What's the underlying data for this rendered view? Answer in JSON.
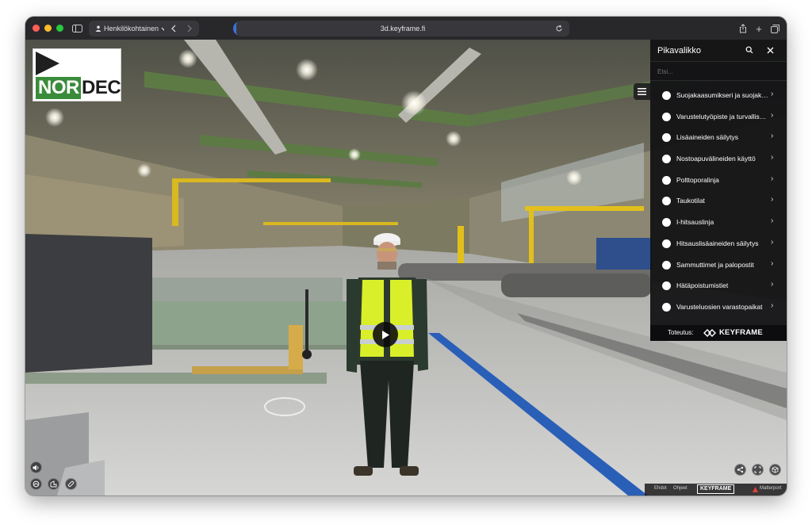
{
  "browser": {
    "profile_label": "Henkilökohtainen",
    "url": "3d.keyframe.fi"
  },
  "logo": {
    "part1": "NOR",
    "part2": "DEC"
  },
  "panel": {
    "title": "Pikavalikko",
    "search_placeholder": "Etsi...",
    "items": [
      {
        "label": "Suojakaasumikseri ja suojakaasut"
      },
      {
        "label": "Varustelutyöpiste ja turvallisuus"
      },
      {
        "label": "Lisäaineiden säilytys"
      },
      {
        "label": "Nostoapuvälineiden käyttö"
      },
      {
        "label": "Polttoporalinja"
      },
      {
        "label": "Taukotilat"
      },
      {
        "label": "I-hitsauslinja"
      },
      {
        "label": "Hitsauslisäaineiden säilytys"
      },
      {
        "label": "Sammuttimet ja palopostit"
      },
      {
        "label": "Hätäpoistumistiet"
      },
      {
        "label": "Varusteluosien varastopaikat"
      }
    ],
    "footer_label": "Toteutus:",
    "footer_brand": "KEYFRAME"
  },
  "bottom_bar": {
    "link1": "Ehdot",
    "link2": "Ohjeet",
    "brand": "KEYFRAME",
    "partner": "Matterport"
  },
  "colors": {
    "accent_green": "#3a8c3a",
    "panel_bg": "#121214",
    "floor_stripe_blue": "#2a5fb8",
    "vest_yellow": "#d9ef2a"
  }
}
